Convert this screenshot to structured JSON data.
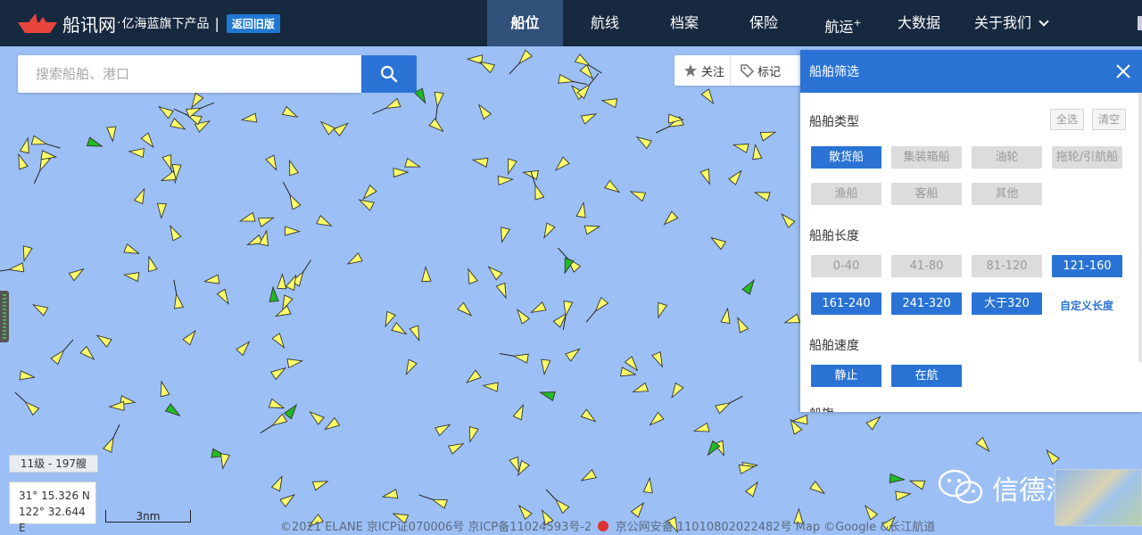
{
  "header": {
    "logo_name": "船讯网",
    "logo_dot": "·",
    "logo_slogan": "亿海蓝旗下产品",
    "logo_sep": "|",
    "old_version": "返回旧版",
    "nav": [
      {
        "label": "船位",
        "active": true
      },
      {
        "label": "航线",
        "active": false
      },
      {
        "label": "档案",
        "active": false
      },
      {
        "label": "保险",
        "active": false
      },
      {
        "label": "航运",
        "sup": "+",
        "active": false
      },
      {
        "label": "大数据",
        "active": false
      },
      {
        "label": "关于我们",
        "active": false
      }
    ]
  },
  "search": {
    "placeholder": "搜索船舶、港口"
  },
  "tools": {
    "follow": "关注",
    "tag": "标记"
  },
  "panel": {
    "title": "船舶筛选",
    "type_title": "船舶类型",
    "select_all": "全选",
    "clear": "清空",
    "types": [
      {
        "label": "散货船",
        "selected": true
      },
      {
        "label": "集装箱船",
        "selected": false
      },
      {
        "label": "油轮",
        "selected": false
      },
      {
        "label": "拖轮/引航船",
        "selected": false
      },
      {
        "label": "渔船",
        "selected": false
      },
      {
        "label": "客船",
        "selected": false
      },
      {
        "label": "其他",
        "selected": false
      }
    ],
    "length_title": "船舶长度",
    "lengths": [
      {
        "label": "0-40",
        "selected": false
      },
      {
        "label": "41-80",
        "selected": false
      },
      {
        "label": "81-120",
        "selected": false
      },
      {
        "label": "121-160",
        "selected": true
      },
      {
        "label": "161-240",
        "selected": true
      },
      {
        "label": "241-320",
        "selected": true
      },
      {
        "label": "大于320",
        "selected": true
      }
    ],
    "custom_length": "自定义长度",
    "speed_title": "船舶速度",
    "speeds": [
      {
        "label": "静止",
        "selected": true
      },
      {
        "label": "在航",
        "selected": true
      }
    ],
    "next_title_partial": "船旗"
  },
  "map": {
    "zoom_level": "11级 - 197艘",
    "lat": "31° 15.326 N",
    "lon": "122° 32.644 E",
    "scale": "3nm",
    "footer": "©2021 ELANE  京ICP证070006号  京ICP备11024593号-2",
    "footer2": "京公网安备 11010802022482号  Map ©Google &长江航道",
    "watermark": "信德海事",
    "colors": {
      "water": "#9cc0f5",
      "ship": "#ffff66",
      "ship_alt": "#22bb22",
      "accent": "#2a73d4"
    }
  }
}
